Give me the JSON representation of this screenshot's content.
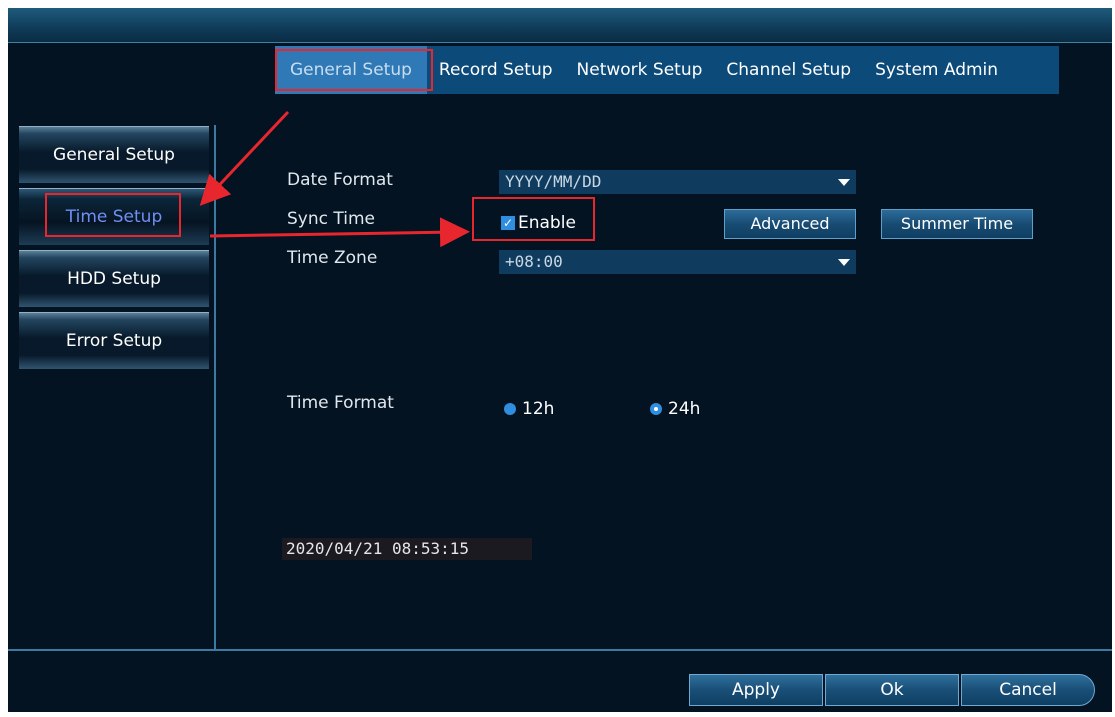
{
  "tabs": [
    {
      "label": "General Setup",
      "active": true
    },
    {
      "label": "Record Setup",
      "active": false
    },
    {
      "label": "Network Setup",
      "active": false
    },
    {
      "label": "Channel Setup",
      "active": false
    },
    {
      "label": "System Admin",
      "active": false
    }
  ],
  "sidebar": {
    "items": [
      {
        "label": "General Setup",
        "active": false
      },
      {
        "label": "Time Setup",
        "active": true
      },
      {
        "label": "HDD Setup",
        "active": false
      },
      {
        "label": "Error Setup",
        "active": false
      }
    ]
  },
  "form": {
    "date_format": {
      "label": "Date Format",
      "value": "YYYY/MM/DD"
    },
    "sync_time": {
      "label": "Sync Time",
      "checkbox_label": "Enable",
      "checked": true
    },
    "advanced_label": "Advanced",
    "summer_time_label": "Summer Time",
    "time_zone": {
      "label": "Time Zone",
      "value": "+08:00"
    },
    "time_format": {
      "label": "Time Format",
      "options": [
        {
          "label": "12h",
          "selected": false
        },
        {
          "label": "24h",
          "selected": true
        }
      ]
    },
    "current_datetime": "2020/04/21 08:53:15"
  },
  "footer": {
    "apply_label": "Apply",
    "ok_label": "Ok",
    "cancel_label": "Cancel"
  },
  "colors": {
    "accent": "#2f79b6",
    "annotation": "#e8262d",
    "background": "#041322"
  },
  "icons": {
    "dropdown": "chevron-down-icon",
    "check": "checkmark-icon"
  }
}
